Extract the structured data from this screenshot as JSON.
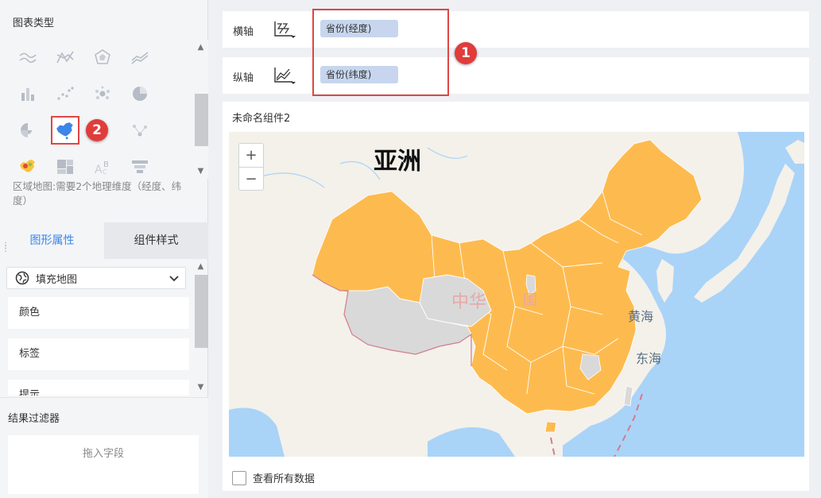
{
  "left_panel": {
    "chart_type_title": "图表类型",
    "chart_icons": [
      "multi-line-chart",
      "polyline-chart",
      "radar-chart",
      "area-chart",
      "stacked-bar-chart",
      "scatter-chart",
      "bubble-chart",
      "pie-chart",
      "rose-chart",
      "fill-map-chart",
      "point-map-chart",
      "flow-map-chart",
      "heat-map-chart",
      "treemap-chart",
      "word-cloud-chart",
      "funnel-chart"
    ],
    "selected_chart": "fill-map-chart",
    "chart_description": "区域地图:需要2个地理维度（经度、纬度）",
    "tabs": {
      "graphic_properties": "图形属性",
      "component_style": "组件样式"
    },
    "map_type_select": "填充地图",
    "property_rows": [
      "颜色",
      "标签",
      "提示"
    ],
    "filter_title": "结果过滤器",
    "filter_placeholder": "拖入字段"
  },
  "axes": {
    "x": {
      "label": "横轴",
      "field": "省份(经度)"
    },
    "y": {
      "label": "纵轴",
      "field": "省份(纬度)"
    }
  },
  "badges": {
    "one": "1",
    "two": "2"
  },
  "component": {
    "title": "未命名组件2",
    "zoom_in": "+",
    "zoom_out": "−",
    "map_labels": {
      "continent": "亚洲",
      "country": "中华",
      "country_tail": "国",
      "yellow_sea": "黄海",
      "east_sea": "东海"
    },
    "view_all_data": "查看所有数据"
  },
  "colors": {
    "accent_blue": "#3b86e8",
    "highlight_red": "#e04545",
    "province_fill": "#fdbb4f",
    "no_data_fill": "#d9d9d9",
    "sea": "#aad3f8",
    "pill_bg": "#c7d6ee"
  }
}
